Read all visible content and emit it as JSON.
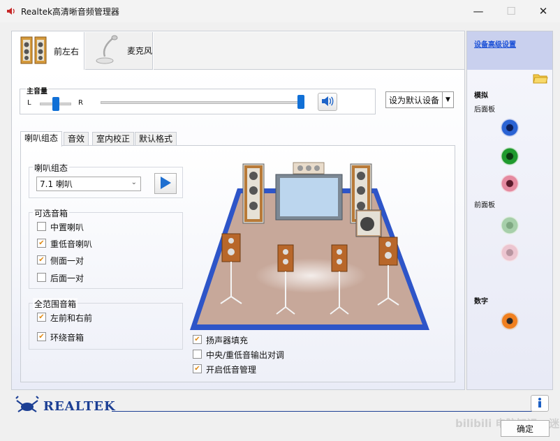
{
  "window": {
    "title": "Realtek高清晰音频管理器",
    "minimize_glyph": "—",
    "maximize_glyph": "☐",
    "close_glyph": "✕"
  },
  "device_tabs": [
    {
      "label": "前左右",
      "icon": "speakers-icon",
      "active": true
    },
    {
      "label": "麦克风",
      "icon": "microphone-icon",
      "active": false
    }
  ],
  "master_volume": {
    "title": "主音量",
    "left_label": "L",
    "right_label": "R",
    "balance_percent": 50,
    "volume_percent": 100,
    "mute_icon": "speaker-volume-icon"
  },
  "default_device_button": {
    "label": "设为默认设备",
    "arrow": "▼"
  },
  "sub_tabs": [
    {
      "label": "喇叭组态",
      "active": true
    },
    {
      "label": "音效",
      "active": false
    },
    {
      "label": "室内校正",
      "active": false
    },
    {
      "label": "默认格式",
      "active": false
    }
  ],
  "speaker_config": {
    "group_title": "喇叭组态",
    "selected": "7.1 喇叭",
    "play_icon": "play-icon"
  },
  "optional_speakers": {
    "title": "可选音箱",
    "items": [
      {
        "label": "中置喇叭",
        "checked": false
      },
      {
        "label": "重低音喇叭",
        "checked": true
      },
      {
        "label": "侧面一对",
        "checked": true
      },
      {
        "label": "后面一对",
        "checked": false
      }
    ]
  },
  "fullrange_speakers": {
    "title": "全范围音箱",
    "items": [
      {
        "label": "左前和右前",
        "checked": true
      },
      {
        "label": "环绕音箱",
        "checked": true
      }
    ]
  },
  "options": [
    {
      "label": "扬声器填充",
      "checked": true
    },
    {
      "label": "中央/重低音输出对调",
      "checked": false
    },
    {
      "label": "开启低音管理",
      "checked": true
    }
  ],
  "right_panel": {
    "advanced_link": "设备高级设置",
    "folder_icon": "folder-icon",
    "analog_label": "模拟",
    "back_panel_label": "后面板",
    "front_panel_label": "前面板",
    "digital_label": "数字",
    "colors": {
      "blue": "#1f4fb8",
      "green": "#1f9a2e",
      "pink": "#e58aa0",
      "green_dim": "#9fc8a2",
      "pink_dim": "#ebc0cb",
      "orange": "#e06a10"
    }
  },
  "footer": {
    "brand": "REALTEK",
    "ok_label": "确定",
    "info_icon": "info-icon",
    "watermark": "bilibili 电脑知识 - 迷"
  }
}
